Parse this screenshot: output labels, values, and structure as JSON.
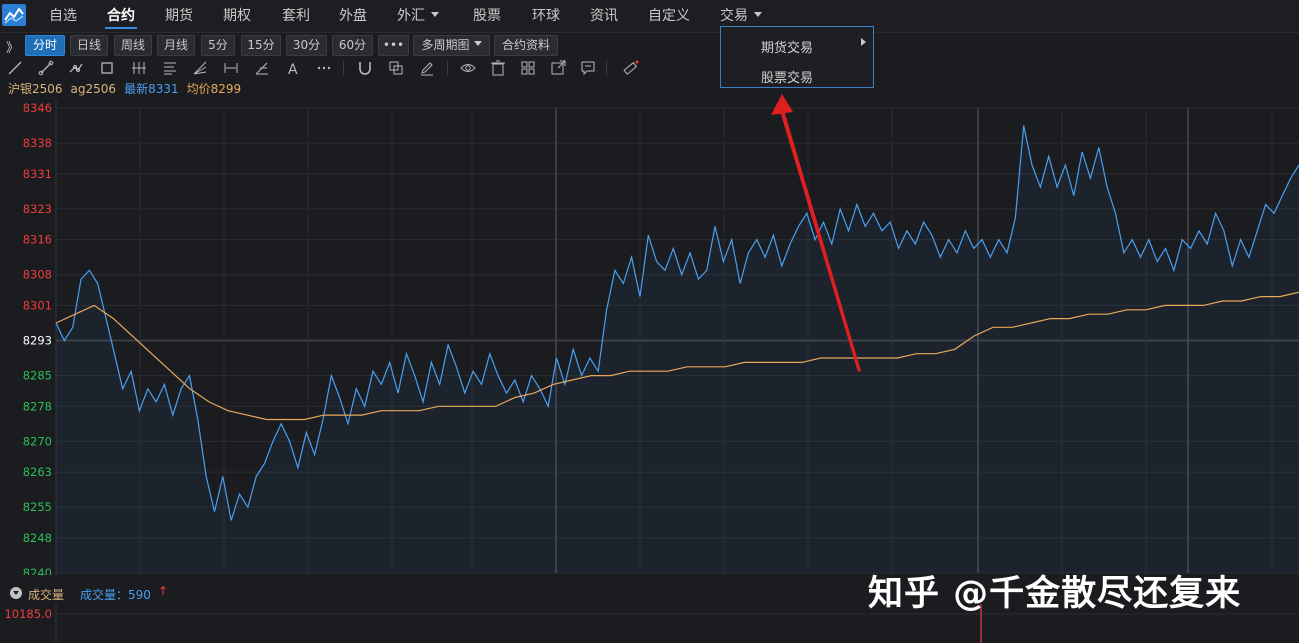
{
  "nav": {
    "items": [
      {
        "label": "自选"
      },
      {
        "label": "合约"
      },
      {
        "label": "期货"
      },
      {
        "label": "期权"
      },
      {
        "label": "套利"
      },
      {
        "label": "外盘"
      },
      {
        "label": "外汇"
      },
      {
        "label": "股票"
      },
      {
        "label": "环球"
      },
      {
        "label": "资讯"
      },
      {
        "label": "自定义"
      },
      {
        "label": "交易"
      }
    ],
    "active": "合约",
    "dropdown_items": [
      "外汇",
      "交易"
    ]
  },
  "period_bar": {
    "expand": "》",
    "buttons": [
      "分时",
      "日线",
      "周线",
      "月线",
      "5分",
      "15分",
      "30分",
      "60分",
      "•••",
      "多周期图",
      "合约资料"
    ],
    "active": "分时"
  },
  "draw_tools": [
    "line-icon",
    "ray-icon",
    "polyline-icon",
    "rect-icon",
    "parallel-icon",
    "fib-icon",
    "fan-icon",
    "measure-icon",
    "angle-icon",
    "text-icon",
    "more-icon",
    "magnet-icon",
    "copy-icon",
    "pencil-icon",
    "eye-icon",
    "trash-icon",
    "grid-icon",
    "export-icon",
    "comment-icon",
    "ruler-icon"
  ],
  "quote": {
    "name": "沪银2506",
    "code": "ag2506",
    "latest": "最新8331",
    "average": "均价8299"
  },
  "trade_menu": {
    "items": [
      "期货交易",
      "股票交易"
    ]
  },
  "volume": {
    "label": "成交量",
    "value_text": "成交量：590",
    "arrow": "↑",
    "scale_top": "10185.0"
  },
  "watermark": "知乎 @千金散尽还复来",
  "colors": {
    "up": "#f03c3c",
    "down": "#2fbe54",
    "price_line": "#4a9ff0",
    "avg_line": "#e8a85a",
    "accent": "#1f6fb8",
    "annotation_arrow": "#e02020"
  },
  "chart_data": {
    "type": "line",
    "yticks": [
      8346,
      8338,
      8331,
      8323,
      8316,
      8308,
      8301,
      8293,
      8285,
      8278,
      8270,
      8263,
      8255,
      8248,
      8240
    ],
    "ylim": [
      8240,
      8346
    ],
    "reference_price": 8293,
    "series": [
      {
        "name": "",
        "values": [
          8297,
          8293,
          8296,
          8307,
          8309,
          8306,
          8298,
          8290,
          8282,
          8286,
          8277,
          8282,
          8279,
          8283,
          8276,
          8282,
          8285,
          8275,
          8262,
          8254,
          8262,
          8252,
          8258,
          8255,
          8262,
          8265,
          8270,
          8274,
          8270,
          8264,
          8272,
          8267,
          8275,
          8285,
          8280,
          8274,
          8282,
          8278,
          8286,
          8283,
          8288,
          8281,
          8290,
          8285,
          8279,
          8288,
          8283,
          8292,
          8287,
          8281,
          8286,
          8283,
          8290,
          8285,
          8281,
          8284,
          8279,
          8285,
          8282,
          8278,
          8289,
          8283,
          8291,
          8285,
          8289,
          8286,
          8300,
          8309,
          8306,
          8312,
          8303,
          8317,
          8311,
          8309,
          8314,
          8308,
          8313,
          8307,
          8309,
          8319,
          8311,
          8316,
          8306,
          8313,
          8316,
          8312,
          8317,
          8310,
          8315,
          8319,
          8322,
          8316,
          8320,
          8315,
          8323,
          8318,
          8324,
          8319,
          8322,
          8318,
          8320,
          8314,
          8318,
          8315,
          8320,
          8317,
          8312,
          8316,
          8313,
          8318,
          8314,
          8316,
          8312,
          8316,
          8313,
          8321,
          8342,
          8333,
          8328,
          8335,
          8328,
          8333,
          8326,
          8336,
          8330,
          8337,
          8328,
          8322,
          8313,
          8316,
          8312,
          8316,
          8311,
          8314,
          8309,
          8316,
          8314,
          8318,
          8315,
          8322,
          8318,
          8310,
          8316,
          8312,
          8318,
          8324,
          8322,
          8326,
          8330,
          8333
        ]
      },
      {
        "name": "",
        "values": [
          8297,
          8299,
          8301,
          8298,
          8294,
          8290,
          8286,
          8282,
          8279,
          8277,
          8276,
          8275,
          8275,
          8275,
          8276,
          8276,
          8276,
          8277,
          8277,
          8277,
          8278,
          8278,
          8278,
          8278,
          8280,
          8281,
          8283,
          8284,
          8285,
          8285,
          8286,
          8286,
          8286,
          8287,
          8287,
          8287,
          8288,
          8288,
          8288,
          8288,
          8289,
          8289,
          8289,
          8289,
          8289,
          8290,
          8290,
          8291,
          8294,
          8296,
          8296,
          8297,
          8298,
          8298,
          8299,
          8299,
          8300,
          8300,
          8301,
          8301,
          8301,
          8302,
          8302,
          8303,
          8303,
          8304
        ]
      }
    ]
  }
}
